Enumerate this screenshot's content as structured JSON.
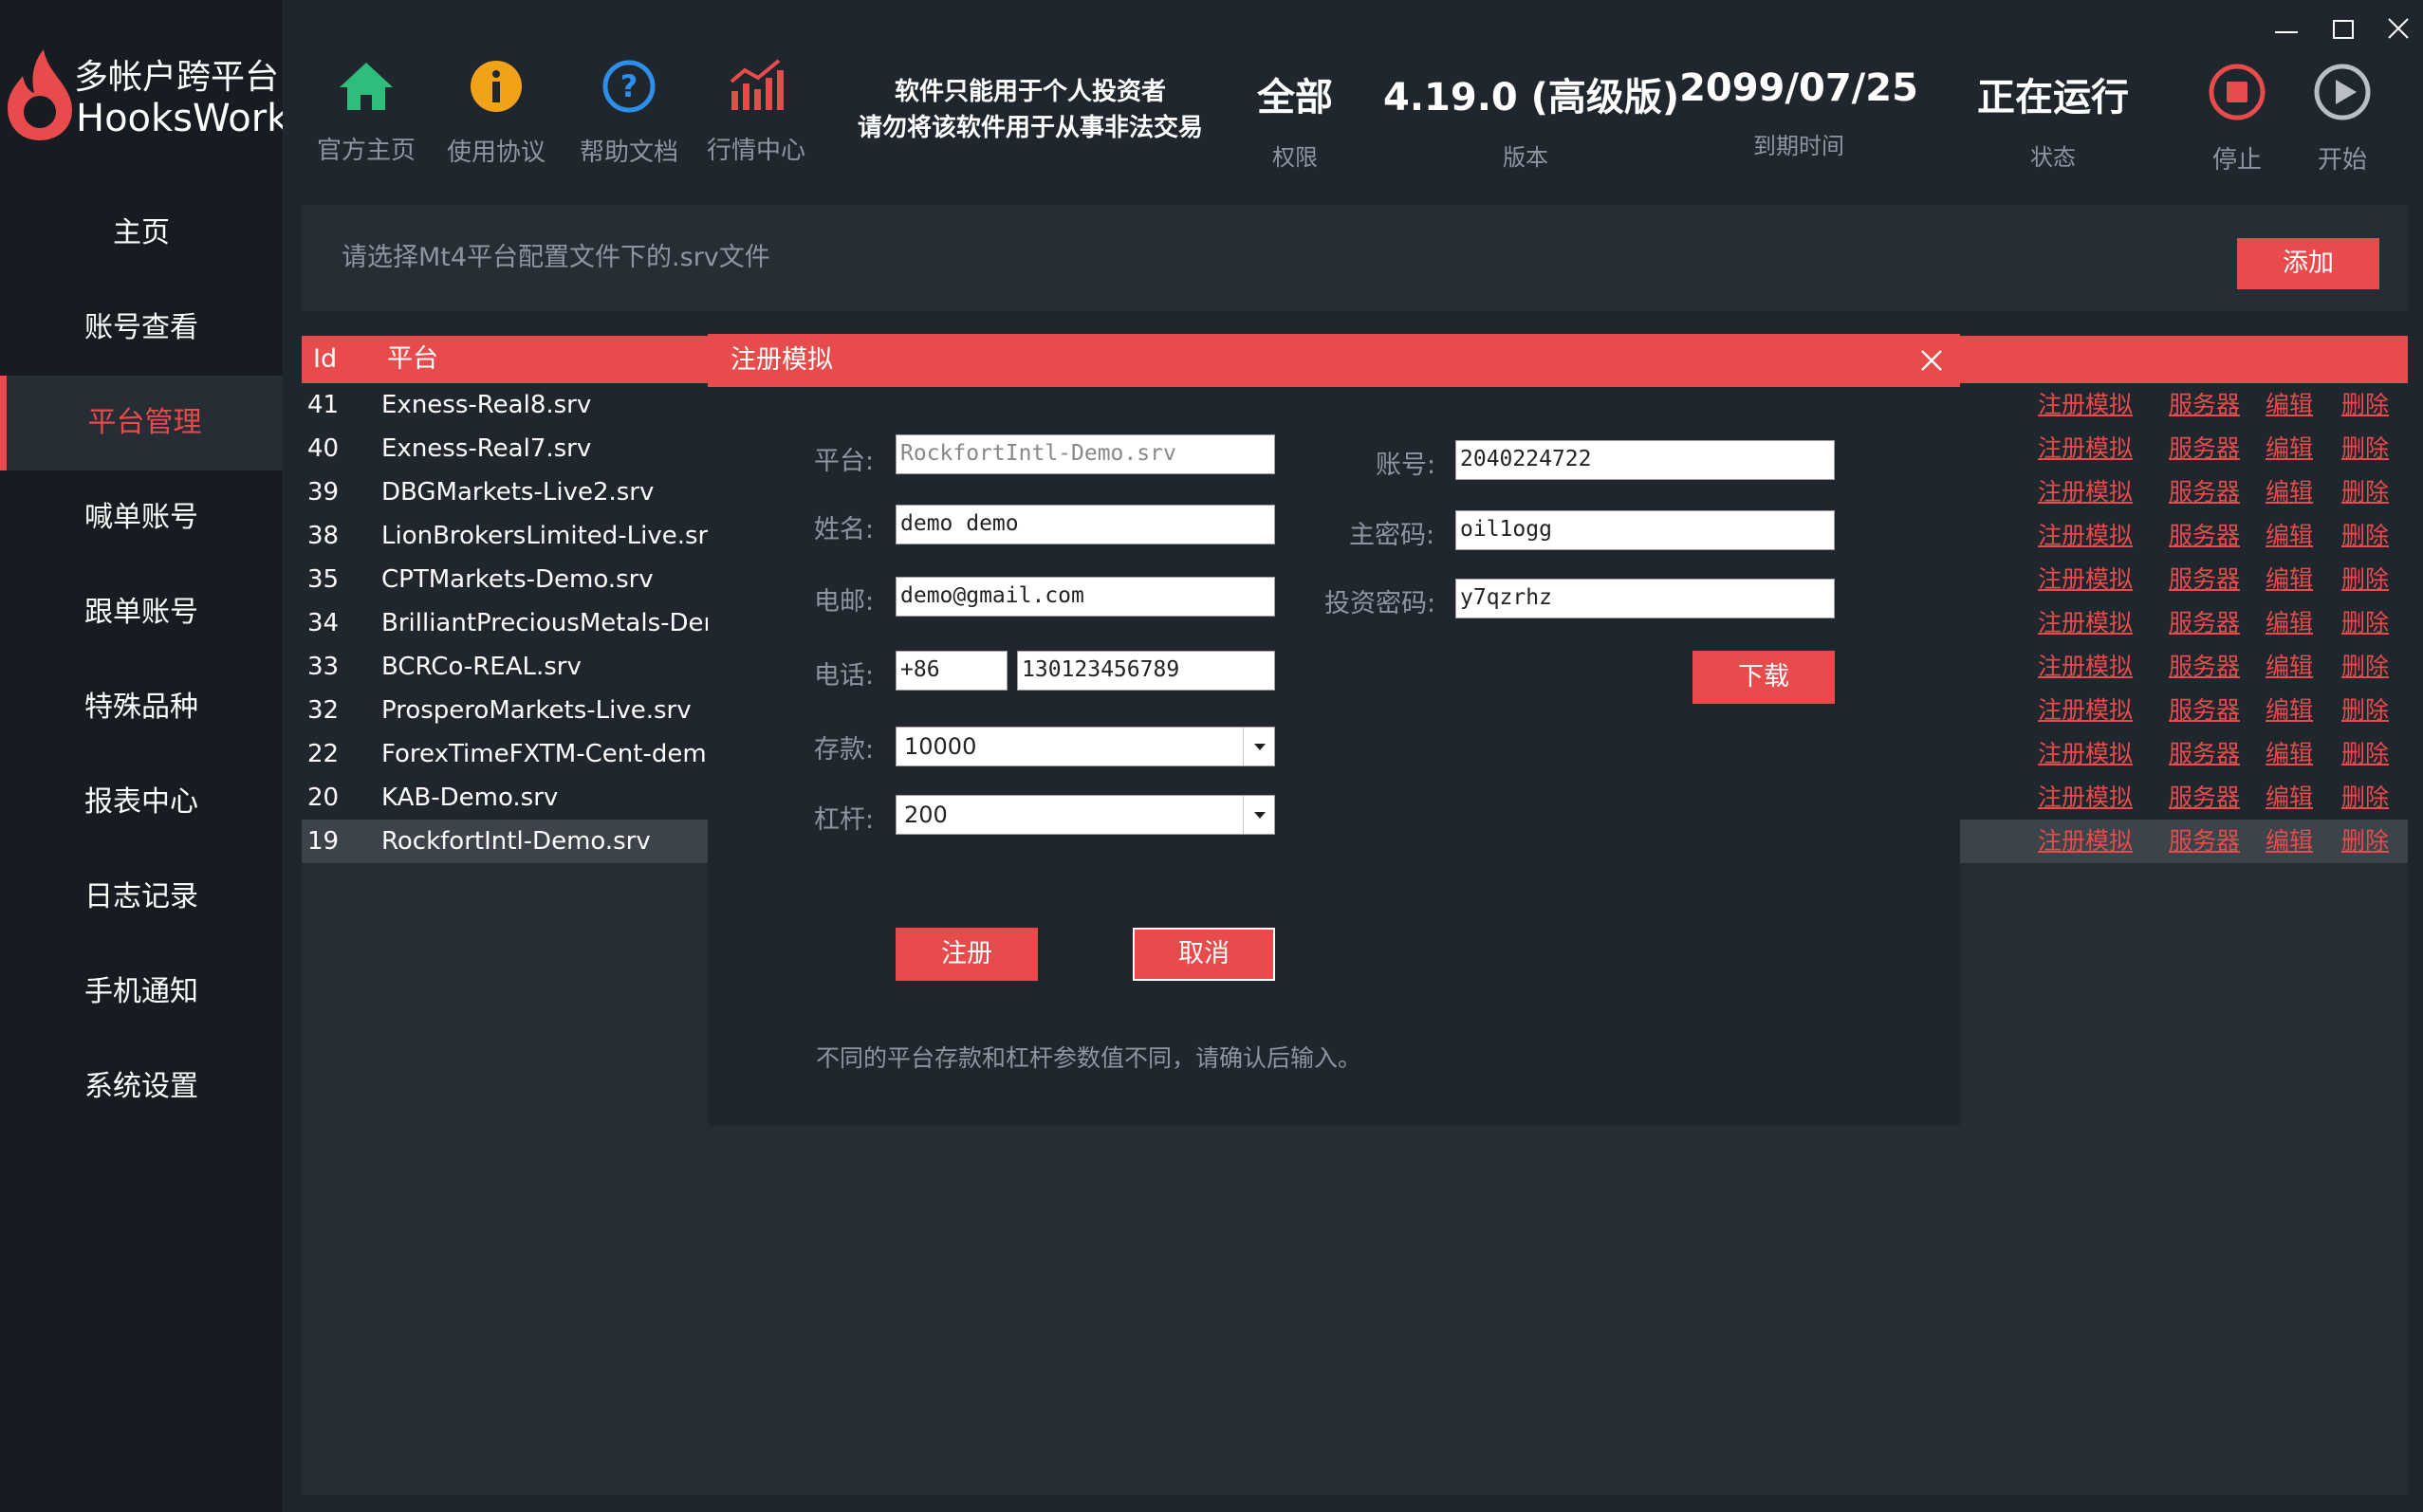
{
  "app": {
    "logo_line1": "多帐户跨平台",
    "logo_line2": "HooksWork",
    "brand_color": "#e84b4b"
  },
  "sidebar": {
    "items": [
      {
        "label": "主页"
      },
      {
        "label": "账号查看"
      },
      {
        "label": "平台管理",
        "active": true
      },
      {
        "label": "喊单账号"
      },
      {
        "label": "跟单账号"
      },
      {
        "label": "特殊品种"
      },
      {
        "label": "报表中心"
      },
      {
        "label": "日志记录"
      },
      {
        "label": "手机通知"
      },
      {
        "label": "系统设置"
      }
    ]
  },
  "toolbar": {
    "tools": [
      {
        "label": "官方主页",
        "icon": "home-icon"
      },
      {
        "label": "使用协议",
        "icon": "info-icon"
      },
      {
        "label": "帮助文档",
        "icon": "help-icon"
      },
      {
        "label": "行情中心",
        "icon": "chart-icon"
      }
    ],
    "notice_line1": "软件只能用于个人投资者",
    "notice_line2": "请勿将该软件用于从事非法交易",
    "stats": [
      {
        "value": "全部",
        "key": "权限"
      },
      {
        "value": "4.19.0 (高级版)",
        "key": "版本"
      },
      {
        "value": "2099/07/25",
        "key": "到期时间"
      },
      {
        "value": "正在运行",
        "key": "状态"
      }
    ],
    "stop_label": "停止",
    "start_label": "开始"
  },
  "content": {
    "path_placeholder": "请选择Mt4平台配置文件下的.srv文件",
    "add_label": "添加",
    "columns": {
      "id": "Id",
      "platform": "平台"
    },
    "row_actions": {
      "register": "注册模拟",
      "server": "服务器",
      "edit": "编辑",
      "delete": "删除"
    },
    "rows": [
      {
        "id": "41",
        "name": "Exness-Real8.srv"
      },
      {
        "id": "40",
        "name": "Exness-Real7.srv"
      },
      {
        "id": "39",
        "name": "DBGMarkets-Live2.srv"
      },
      {
        "id": "38",
        "name": "LionBrokersLimited-Live.srv"
      },
      {
        "id": "35",
        "name": "CPTMarkets-Demo.srv"
      },
      {
        "id": "34",
        "name": "BrilliantPreciousMetals-Demo"
      },
      {
        "id": "33",
        "name": "BCRCo-REAL.srv"
      },
      {
        "id": "32",
        "name": "ProsperoMarkets-Live.srv"
      },
      {
        "id": "22",
        "name": "ForexTimeFXTM-Cent-demo.s"
      },
      {
        "id": "20",
        "name": "KAB-Demo.srv"
      },
      {
        "id": "19",
        "name": "RockfortIntl-Demo.srv",
        "selected": true
      }
    ]
  },
  "modal": {
    "title": "注册模拟",
    "platform_label": "平台:",
    "platform_value": "RockfortIntl-Demo.srv",
    "name_label": "姓名:",
    "name_value": "demo demo",
    "email_label": "电邮:",
    "email_value": "demo@gmail.com",
    "phone_label": "电话:",
    "phone_code": "+86",
    "phone_value": "130123456789",
    "deposit_label": "存款:",
    "deposit_value": "10000",
    "leverage_label": "杠杆:",
    "leverage_value": "200",
    "account_label": "账号:",
    "account_value": "2040224722",
    "master_pwd_label": "主密码:",
    "master_pwd_value": "oil1ogg",
    "investor_pwd_label": "投资密码:",
    "investor_pwd_value": "y7qzrhz",
    "download_label": "下载",
    "register_label": "注册",
    "cancel_label": "取消",
    "note": "不同的平台存款和杠杆参数值不同，请确认后输入。"
  }
}
